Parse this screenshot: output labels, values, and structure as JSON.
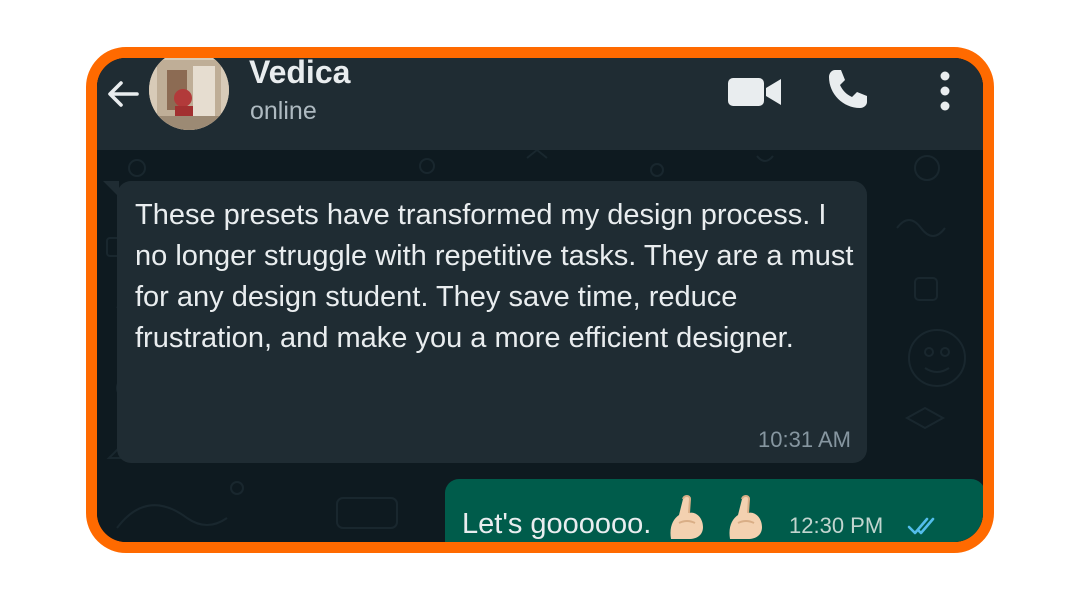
{
  "header": {
    "back_icon": "arrow-left-icon",
    "contact_name": "Vedica",
    "contact_status": "online",
    "actions": [
      "video-call-icon",
      "voice-call-icon",
      "more-options-icon"
    ]
  },
  "messages": [
    {
      "direction": "incoming",
      "text": "These presets have transformed my design process. I no longer struggle with repetitive tasks. They are a must for any design student. They save time, reduce frustration, and make you a more efficient designer.",
      "time": "10:31 AM"
    },
    {
      "direction": "outgoing",
      "text": "Let's goooooo.",
      "emoji": [
        "pinched-fingers",
        "pinched-fingers"
      ],
      "time": "12:30 PM",
      "read_status": "double-check-blue"
    }
  ],
  "colors": {
    "frame_border": "#ff6a00",
    "header_bg": "#1f2c33",
    "chat_bg": "#0e1a20",
    "incoming_bubble": "#1f2c33",
    "outgoing_bubble": "#005c4b",
    "read_ticks": "#53bdeb"
  }
}
